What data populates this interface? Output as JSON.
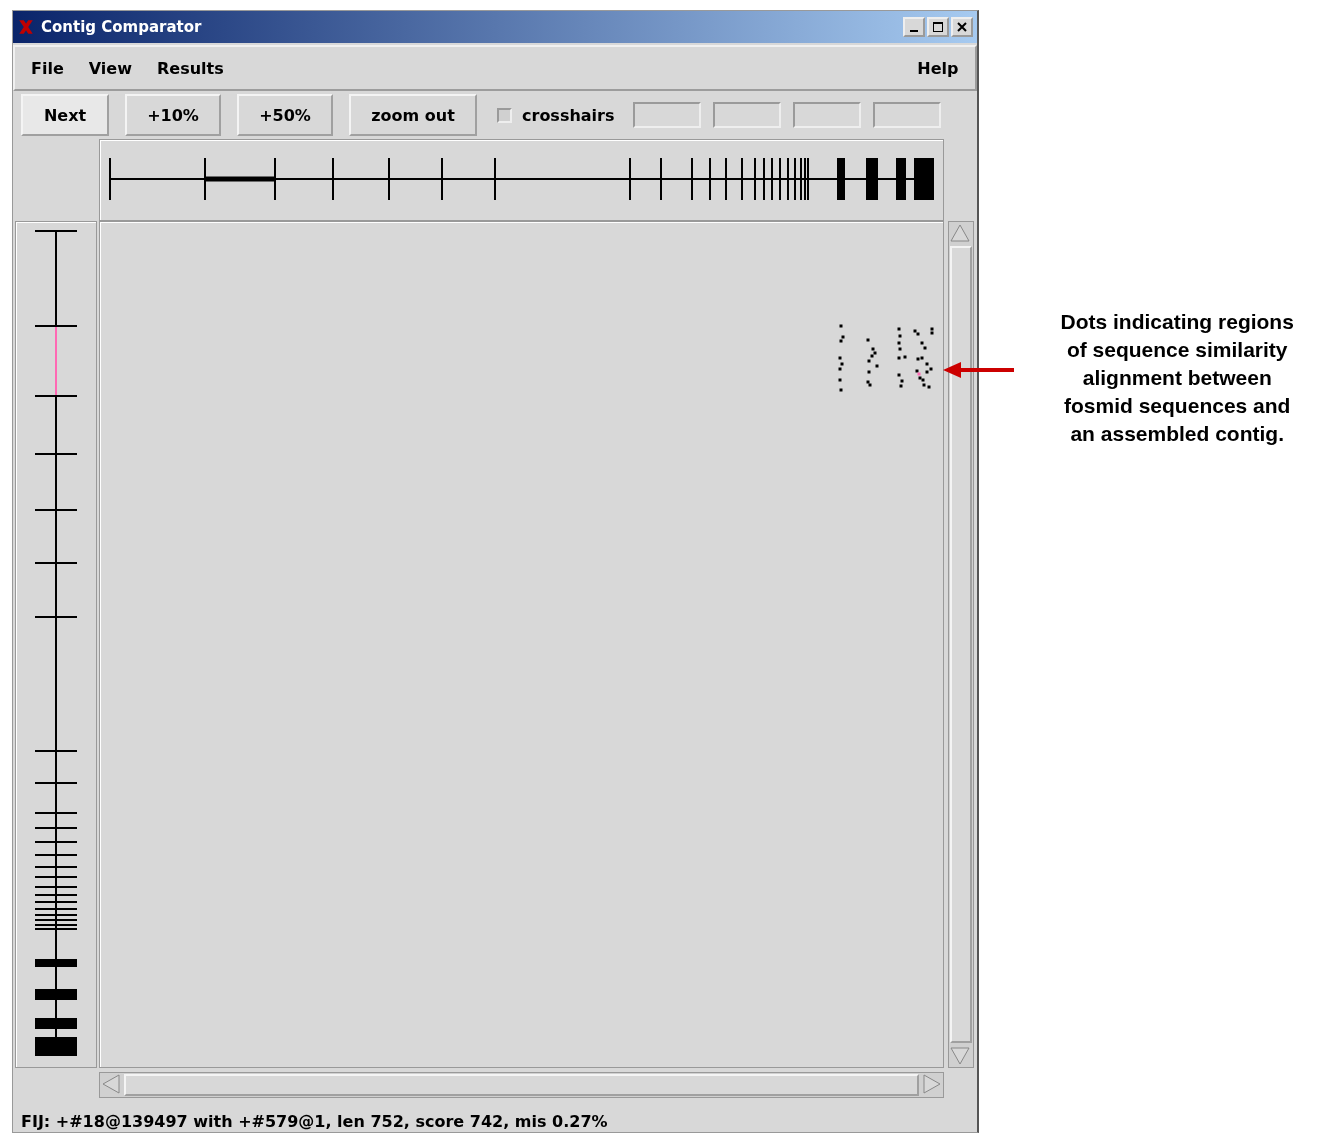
{
  "window": {
    "title": "Contig Comparator"
  },
  "menu": [
    {
      "label": "File"
    },
    {
      "label": "View"
    },
    {
      "label": "Results"
    }
  ],
  "help_menu": {
    "label": "Help"
  },
  "toolbar": {
    "buttons": [
      {
        "label": "Next"
      },
      {
        "label": "+10%"
      },
      {
        "label": "+50%"
      },
      {
        "label": "zoom out"
      }
    ],
    "crosshairs": {
      "label": "crosshairs",
      "checked": false
    }
  },
  "status_bar": "FIJ: +#18@139497 with +#579@1, len 752, score 742, mis 0.27%",
  "annotation": {
    "lines": [
      "Dots indicating regions",
      "of sequence similarity",
      "alignment between",
      "fosmid sequences and",
      "an assembled contig."
    ]
  }
}
